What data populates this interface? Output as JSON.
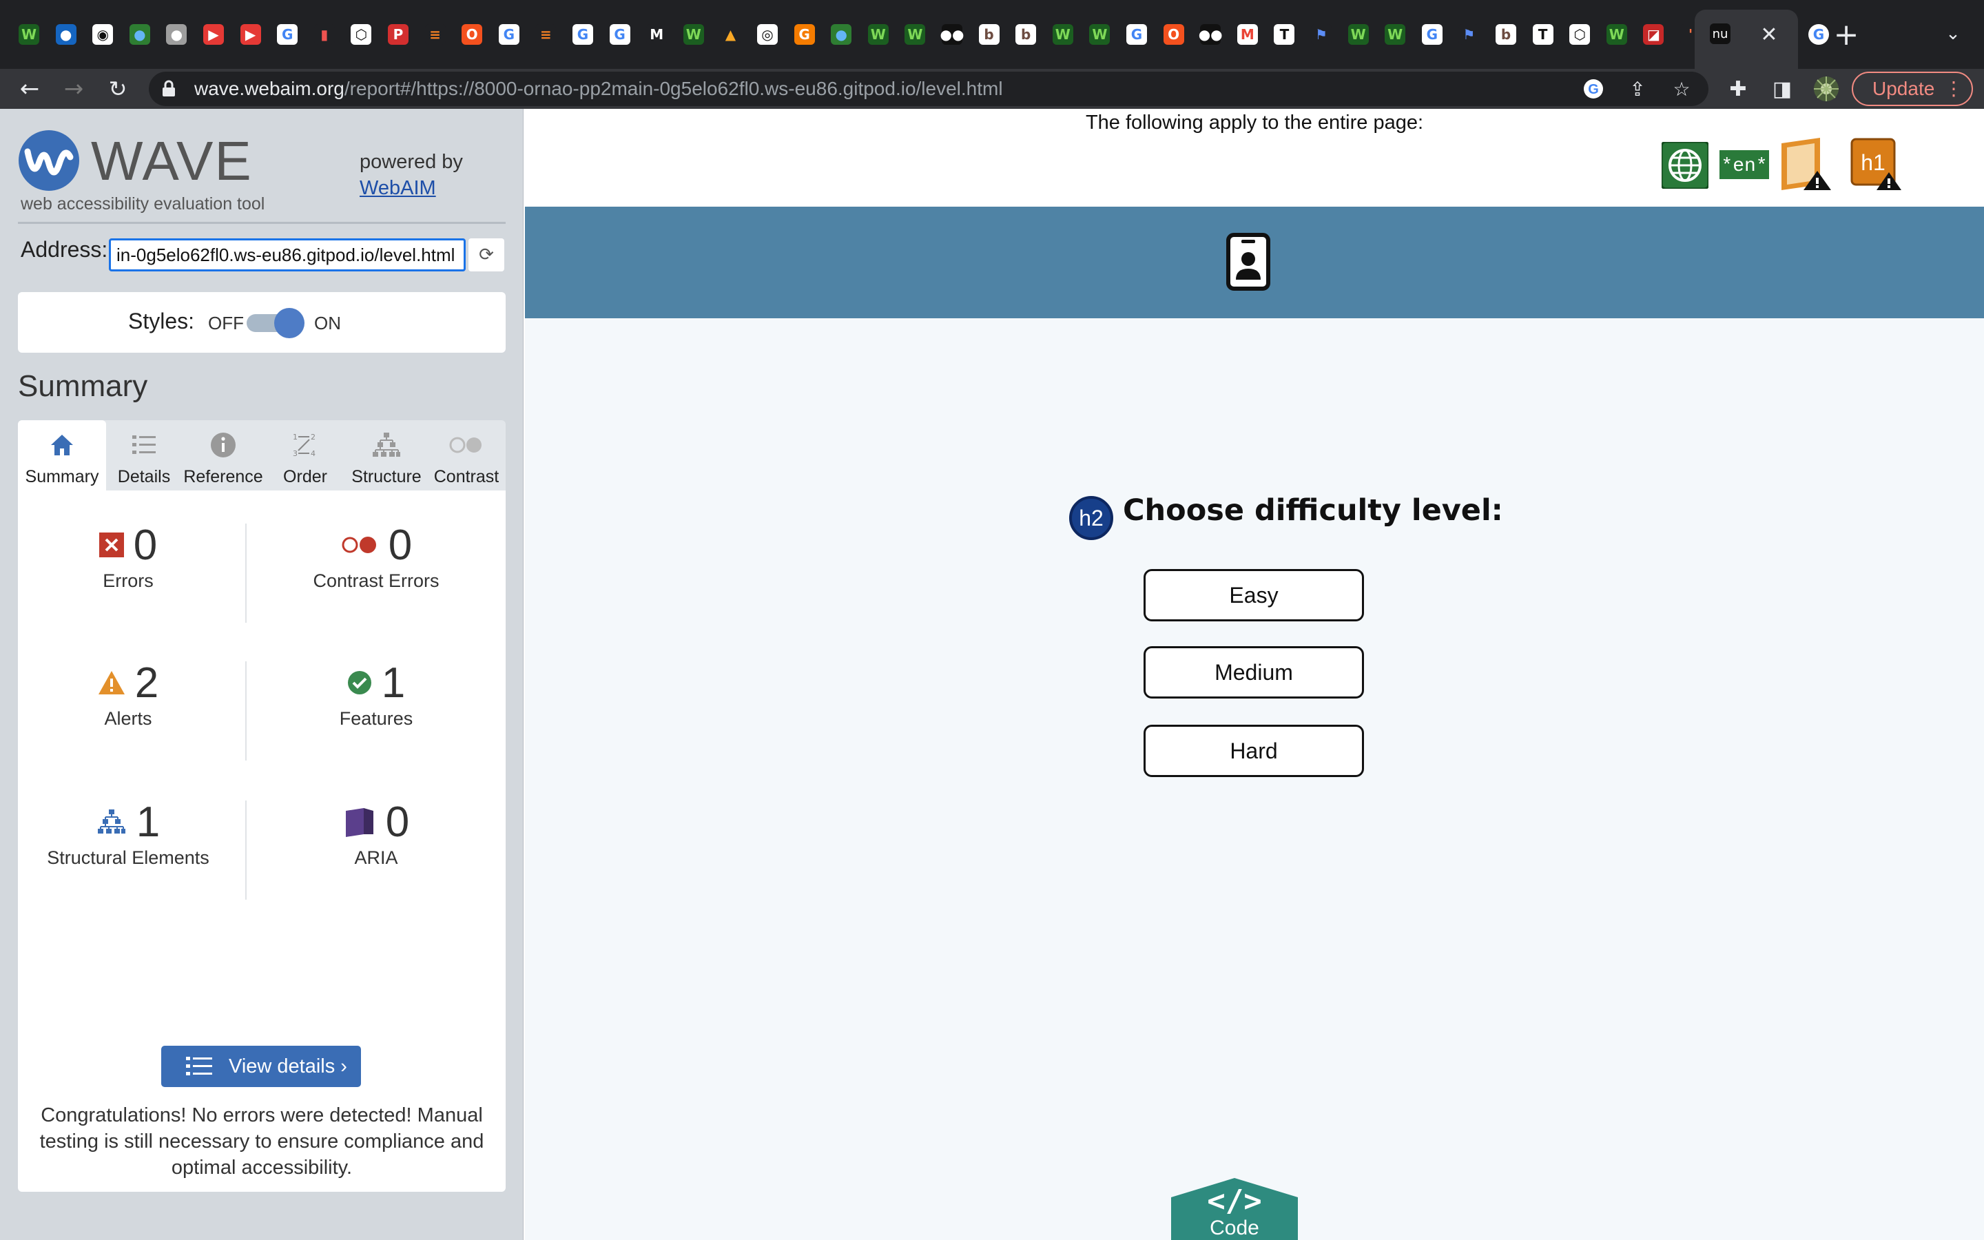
{
  "browser": {
    "active_tab_title": "nu",
    "new_tab_symbol": "+",
    "close_symbol": "✕",
    "tab_menu_symbol": "⌄",
    "url_host": "wave.webaim.org",
    "url_path": "/report#/https://8000-ornao-pp2main-0g5elo62fl0.ws-eu86.gitpod.io/level.html",
    "update_label": "Update",
    "favicons": [
      {
        "glyph": "W",
        "bg": "#1b5e20",
        "fg": "#7ed957"
      },
      {
        "glyph": "●",
        "bg": "#1565c0",
        "fg": "#ffffff"
      },
      {
        "glyph": "◉",
        "bg": "#ffffff",
        "fg": "#111111"
      },
      {
        "glyph": "●",
        "bg": "#2e7d32",
        "fg": "#64b5f6"
      },
      {
        "glyph": "●",
        "bg": "#9e9e9e",
        "fg": "#ffffff"
      },
      {
        "glyph": "▶",
        "bg": "#e53935",
        "fg": "#ffffff"
      },
      {
        "glyph": "▶",
        "bg": "#e53935",
        "fg": "#ffffff"
      },
      {
        "glyph": "G",
        "bg": "#ffffff",
        "fg": "#4285f4"
      },
      {
        "glyph": "▮",
        "bg": "#202124",
        "fg": "#ef5350"
      },
      {
        "glyph": "⬡",
        "bg": "#ffffff",
        "fg": "#111111"
      },
      {
        "glyph": "P",
        "bg": "#d32f2f",
        "fg": "#ffffff"
      },
      {
        "glyph": "≡",
        "bg": "#202124",
        "fg": "#f48024"
      },
      {
        "glyph": "O",
        "bg": "#f4511e",
        "fg": "#ffffff"
      },
      {
        "glyph": "G",
        "bg": "#ffffff",
        "fg": "#4285f4"
      },
      {
        "glyph": "≡",
        "bg": "#202124",
        "fg": "#f48024"
      },
      {
        "glyph": "G",
        "bg": "#ffffff",
        "fg": "#4285f4"
      },
      {
        "glyph": "G",
        "bg": "#ffffff",
        "fg": "#4285f4"
      },
      {
        "glyph": "M",
        "bg": "#202124",
        "fg": "#ffffff"
      },
      {
        "glyph": "W",
        "bg": "#1b5e20",
        "fg": "#7ed957"
      },
      {
        "glyph": "▲",
        "bg": "#202124",
        "fg": "#f9a825"
      },
      {
        "glyph": "◎",
        "bg": "#ffffff",
        "fg": "#111111"
      },
      {
        "glyph": "G",
        "bg": "#f57c00",
        "fg": "#ffffff"
      },
      {
        "glyph": "●",
        "bg": "#2e7d32",
        "fg": "#64b5f6"
      },
      {
        "glyph": "W",
        "bg": "#1b5e20",
        "fg": "#7ed957"
      },
      {
        "glyph": "W",
        "bg": "#1b5e20",
        "fg": "#7ed957"
      },
      {
        "glyph": "●●",
        "bg": "#111111",
        "fg": "#ffffff"
      },
      {
        "glyph": "b",
        "bg": "#ffffff",
        "fg": "#6d4c41"
      },
      {
        "glyph": "b",
        "bg": "#ffffff",
        "fg": "#6d4c41"
      },
      {
        "glyph": "W",
        "bg": "#1b5e20",
        "fg": "#7ed957"
      },
      {
        "glyph": "W",
        "bg": "#1b5e20",
        "fg": "#7ed957"
      },
      {
        "glyph": "G",
        "bg": "#ffffff",
        "fg": "#4285f4"
      },
      {
        "glyph": "O",
        "bg": "#f4511e",
        "fg": "#ffffff"
      },
      {
        "glyph": "●●",
        "bg": "#111111",
        "fg": "#ffffff"
      },
      {
        "glyph": "M",
        "bg": "#ffffff",
        "fg": "#ea4335"
      },
      {
        "glyph": "T",
        "bg": "#ffffff",
        "fg": "#111111"
      },
      {
        "glyph": "⚑",
        "bg": "#202124",
        "fg": "#5c8df6"
      },
      {
        "glyph": "W",
        "bg": "#1b5e20",
        "fg": "#7ed957"
      },
      {
        "glyph": "W",
        "bg": "#1b5e20",
        "fg": "#7ed957"
      },
      {
        "glyph": "G",
        "bg": "#ffffff",
        "fg": "#4285f4"
      },
      {
        "glyph": "⚑",
        "bg": "#202124",
        "fg": "#5c8df6"
      },
      {
        "glyph": "b",
        "bg": "#ffffff",
        "fg": "#6d4c41"
      },
      {
        "glyph": "T",
        "bg": "#ffffff",
        "fg": "#111111"
      },
      {
        "glyph": "⬡",
        "bg": "#ffffff",
        "fg": "#111111"
      },
      {
        "glyph": "W",
        "bg": "#1b5e20",
        "fg": "#7ed957"
      },
      {
        "glyph": "◪",
        "bg": "#c62828",
        "fg": "#ffffff"
      },
      {
        "glyph": "'",
        "bg": "#202124",
        "fg": "#ff7043"
      }
    ],
    "trailing_favicon": {
      "glyph": "G",
      "bg": "#ffffff",
      "fg": "#4285f4"
    }
  },
  "wave": {
    "title": "WAVE",
    "subtitle": "web accessibility evaluation tool",
    "powered_by": "powered by",
    "webaim_link": "WebAIM",
    "address_label": "Address:",
    "address_value": "in-0g5elo62fl0.ws-eu86.gitpod.io/level.html",
    "styles_label": "Styles:",
    "styles_off": "OFF",
    "styles_on": "ON",
    "summary_heading": "Summary",
    "tabs": [
      {
        "label": "Summary",
        "icon": "home-icon"
      },
      {
        "label": "Details",
        "icon": "list-icon"
      },
      {
        "label": "Reference",
        "icon": "info-icon"
      },
      {
        "label": "Order",
        "icon": "order-icon"
      },
      {
        "label": "Structure",
        "icon": "structure-icon"
      },
      {
        "label": "Contrast",
        "icon": "contrast-icon"
      }
    ],
    "stats": {
      "errors": {
        "value": "0",
        "label": "Errors"
      },
      "contrast_errors": {
        "value": "0",
        "label": "Contrast Errors"
      },
      "alerts": {
        "value": "2",
        "label": "Alerts"
      },
      "features": {
        "value": "1",
        "label": "Features"
      },
      "structural": {
        "value": "1",
        "label": "Structural Elements"
      },
      "aria": {
        "value": "0",
        "label": "ARIA"
      }
    },
    "view_details": "View details ›",
    "congrats": "Congratulations! No errors were detected! Manual testing is still necessary to ensure compliance and optimal accessibility."
  },
  "page": {
    "applies_text": "The following apply to the entire page:",
    "lang_badge": "*en*",
    "h1_badge": "h1",
    "h2_badge": "h2",
    "heading": "Choose difficulty level:",
    "buttons": [
      "Easy",
      "Medium",
      "Hard"
    ],
    "code_label": "Code",
    "code_symbol": "</>"
  },
  "colors": {
    "banner": "#4f83a5",
    "wave_blue": "#3a6db5",
    "error_red": "#c0392b",
    "alert_orange": "#e3902b",
    "feature_green": "#3a8a4f",
    "aria_purple": "#5b3f8c",
    "code_teal": "#2e8b7f"
  }
}
